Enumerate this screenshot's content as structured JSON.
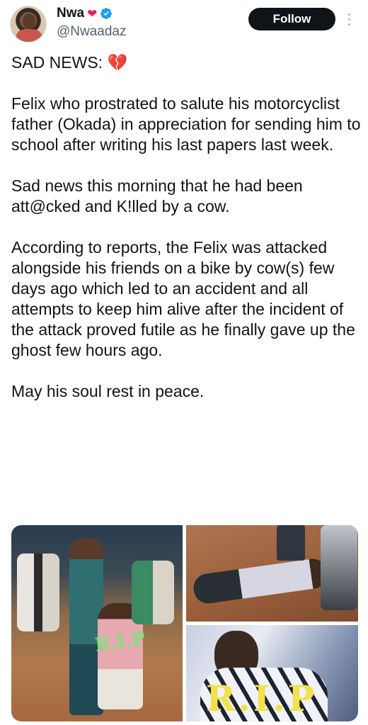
{
  "author": {
    "name": "Nwa",
    "handle": "@Nwaadaz",
    "name_emoji": "heart-emoji",
    "verified": "verified-badge-icon"
  },
  "actions": {
    "follow_label": "Follow",
    "more_icon": "more-vertical-icon"
  },
  "tweet": {
    "heading": "SAD NEWS:",
    "heading_emoji": "💔",
    "paragraphs": [
      "Felix who prostrated to salute his motorcyclist father (Okada) in appreciation for sending him to school after writing his last papers last week.",
      "Sad news this morning that he had been att@cked and K!lled by a cow.",
      "According to reports, the Felix was attacked alongside his friends on a bike by cow(s) few days ago which led to an accident and all attempts to keep him alive after the incident of the attack proved futile as he finally gave up the ghost few hours ago.",
      "May his soul rest in peace."
    ]
  },
  "media": {
    "photos": [
      {
        "overlay_text": "R.I.P"
      },
      {
        "overlay_text": ""
      },
      {
        "overlay_text": "R.I.P"
      }
    ]
  },
  "colors": {
    "follow_bg": "#0f1419",
    "handle": "#536471",
    "verified": "#1d9bf0",
    "heart": "#e0245e"
  }
}
